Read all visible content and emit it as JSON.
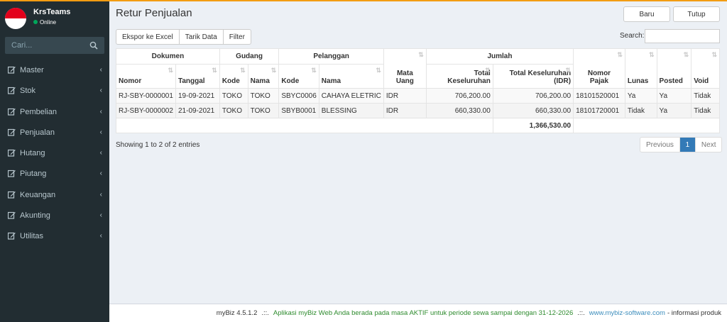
{
  "user": {
    "name": "KrsTeams",
    "status": "Online"
  },
  "sidebar": {
    "search_placeholder": "Cari...",
    "items": [
      {
        "label": "Master"
      },
      {
        "label": "Stok"
      },
      {
        "label": "Pembelian"
      },
      {
        "label": "Penjualan"
      },
      {
        "label": "Hutang"
      },
      {
        "label": "Piutang"
      },
      {
        "label": "Keuangan"
      },
      {
        "label": "Akunting"
      },
      {
        "label": "Utilitas"
      }
    ]
  },
  "page": {
    "title": "Retur Penjualan",
    "new_label": "Baru",
    "close_label": "Tutup"
  },
  "toolbar": {
    "export_label": "Ekspor ke Excel",
    "pull_label": "Tarik Data",
    "filter_label": "Filter",
    "search_label": "Search:"
  },
  "table": {
    "groups": {
      "dokumen": "Dokumen",
      "gudang": "Gudang",
      "pelanggan": "Pelanggan",
      "jumlah": "Jumlah"
    },
    "columns": {
      "nomor": "Nomor",
      "tanggal": "Tanggal",
      "gudang_kode": "Kode",
      "gudang_nama": "Nama",
      "pel_kode": "Kode",
      "pel_nama": "Nama",
      "mata_uang_1": "Mata",
      "mata_uang_2": "Uang",
      "total_1": "Total",
      "total_2": "Keseluruhan",
      "total_idr_1": "Total Keseluruhan",
      "total_idr_2": "(IDR)",
      "pajak_1": "Nomor",
      "pajak_2": "Pajak",
      "lunas": "Lunas",
      "posted": "Posted",
      "void": "Void"
    },
    "rows": [
      {
        "nomor": "RJ-SBY-0000001",
        "tanggal": "19-09-2021",
        "gudang_kode": "TOKO",
        "gudang_nama": "TOKO",
        "pel_kode": "SBYC0006",
        "pel_nama": "CAHAYA ELETRIC",
        "mata_uang": "IDR",
        "total": "706,200.00",
        "total_idr": "706,200.00",
        "pajak": "18101520001",
        "lunas": "Ya",
        "posted": "Ya",
        "void": "Tidak"
      },
      {
        "nomor": "RJ-SBY-0000002",
        "tanggal": "21-09-2021",
        "gudang_kode": "TOKO",
        "gudang_nama": "TOKO",
        "pel_kode": "SBYB0001",
        "pel_nama": "BLESSING",
        "mata_uang": "IDR",
        "total": "660,330.00",
        "total_idr": "660,330.00",
        "pajak": "18101720001",
        "lunas": "Tidak",
        "posted": "Ya",
        "void": "Tidak"
      }
    ],
    "grand_total": "1,366,530.00"
  },
  "pagination": {
    "info": "Showing 1 to 2 of 2 entries",
    "previous": "Previous",
    "current": "1",
    "next": "Next"
  },
  "footer": {
    "version": "myBiz 4.5.1.2",
    "separator": ".::.",
    "message": "Aplikasi myBiz Web Anda berada pada masa AKTIF untuk periode sewa sampai dengan 31-12-2026",
    "link": "www.mybiz-software.com",
    "info": "- informasi produk"
  },
  "icons": {
    "menu": "edit-icon",
    "search": "search-icon",
    "chevron": "chevron-left-icon",
    "sort": "sort-icon"
  },
  "colors": {
    "sidebar": "#222d32",
    "accent": "#f39c12",
    "active_page": "#337ab7",
    "footer_message": "#2e8b2e",
    "link": "#3c8dbc"
  }
}
